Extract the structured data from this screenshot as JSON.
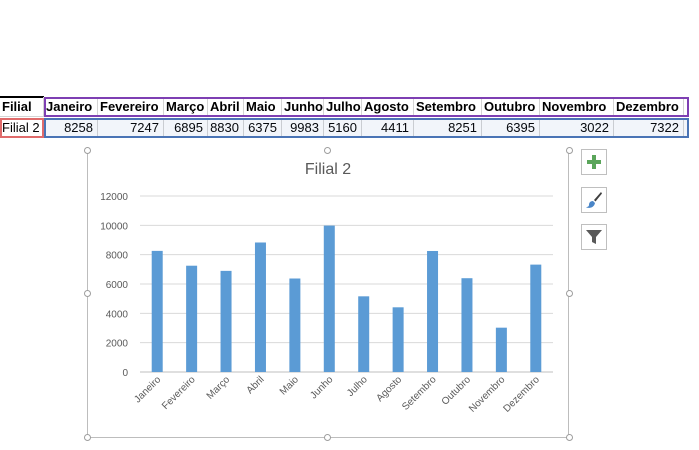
{
  "sheet": {
    "header": [
      "Filial",
      "Janeiro",
      "Fevereiro",
      "Março",
      "Abril",
      "Maio",
      "Junho",
      "Julho",
      "Agosto",
      "Setembro",
      "Outubro",
      "Novembro",
      "Dezembro"
    ],
    "row": [
      "Filial 2",
      "8258",
      "7247",
      "6895",
      "8830",
      "6375",
      "9983",
      "5160",
      "4411",
      "8251",
      "6395",
      "3022",
      "7322"
    ]
  },
  "colors": {
    "bar": "#5b9bd5",
    "grid": "#d9d9d9",
    "axis_text": "#595959",
    "highlight_purple": "#7e3fb3",
    "highlight_blue": "#4a74b5",
    "highlight_red": "#e06b6b",
    "plus_icon": "#5aa55a"
  },
  "side_buttons": [
    {
      "icon": "plus-icon"
    },
    {
      "icon": "paintbrush-icon"
    },
    {
      "icon": "filter-icon"
    }
  ],
  "chart_data": {
    "type": "bar",
    "title": "Filial 2",
    "categories": [
      "Janeiro",
      "Fevereiro",
      "Março",
      "Abril",
      "Maio",
      "Junho",
      "Julho",
      "Agosto",
      "Setembro",
      "Outubro",
      "Novembro",
      "Dezembro"
    ],
    "series": [
      {
        "values": [
          8258,
          7247,
          6895,
          8830,
          6375,
          9983,
          5160,
          4411,
          8251,
          6395,
          3022,
          7322
        ]
      }
    ],
    "yticks": [
      "0",
      "2000",
      "4000",
      "6000",
      "8000",
      "10000",
      "12000"
    ],
    "ylim": [
      0,
      12000
    ],
    "grid": true,
    "legend": "none"
  }
}
